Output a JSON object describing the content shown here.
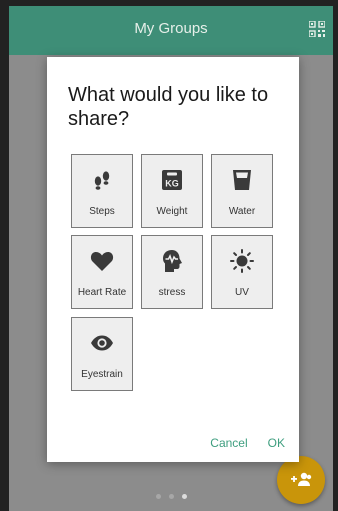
{
  "appbar": {
    "title": "My Groups",
    "qr_icon": "qr-code-icon"
  },
  "dialog": {
    "title": "What would you like to share?",
    "options": [
      {
        "label": "Steps",
        "icon": "footsteps-icon"
      },
      {
        "label": "Weight",
        "icon": "kg-weight-icon"
      },
      {
        "label": "Water",
        "icon": "water-glass-icon"
      },
      {
        "label": "Heart Rate",
        "icon": "heart-icon"
      },
      {
        "label": "stress",
        "icon": "head-stress-icon"
      },
      {
        "label": "UV",
        "icon": "sun-icon"
      },
      {
        "label": "Eyestrain",
        "icon": "eye-icon"
      }
    ],
    "cancel_label": "Cancel",
    "ok_label": "OK"
  },
  "pager": {
    "count": 3,
    "active_index": 2
  },
  "fab": {
    "icon": "add-group-icon"
  },
  "colors": {
    "primary": "#3e8e77",
    "accent": "#c9950a",
    "action_text": "#3e9e7f"
  }
}
